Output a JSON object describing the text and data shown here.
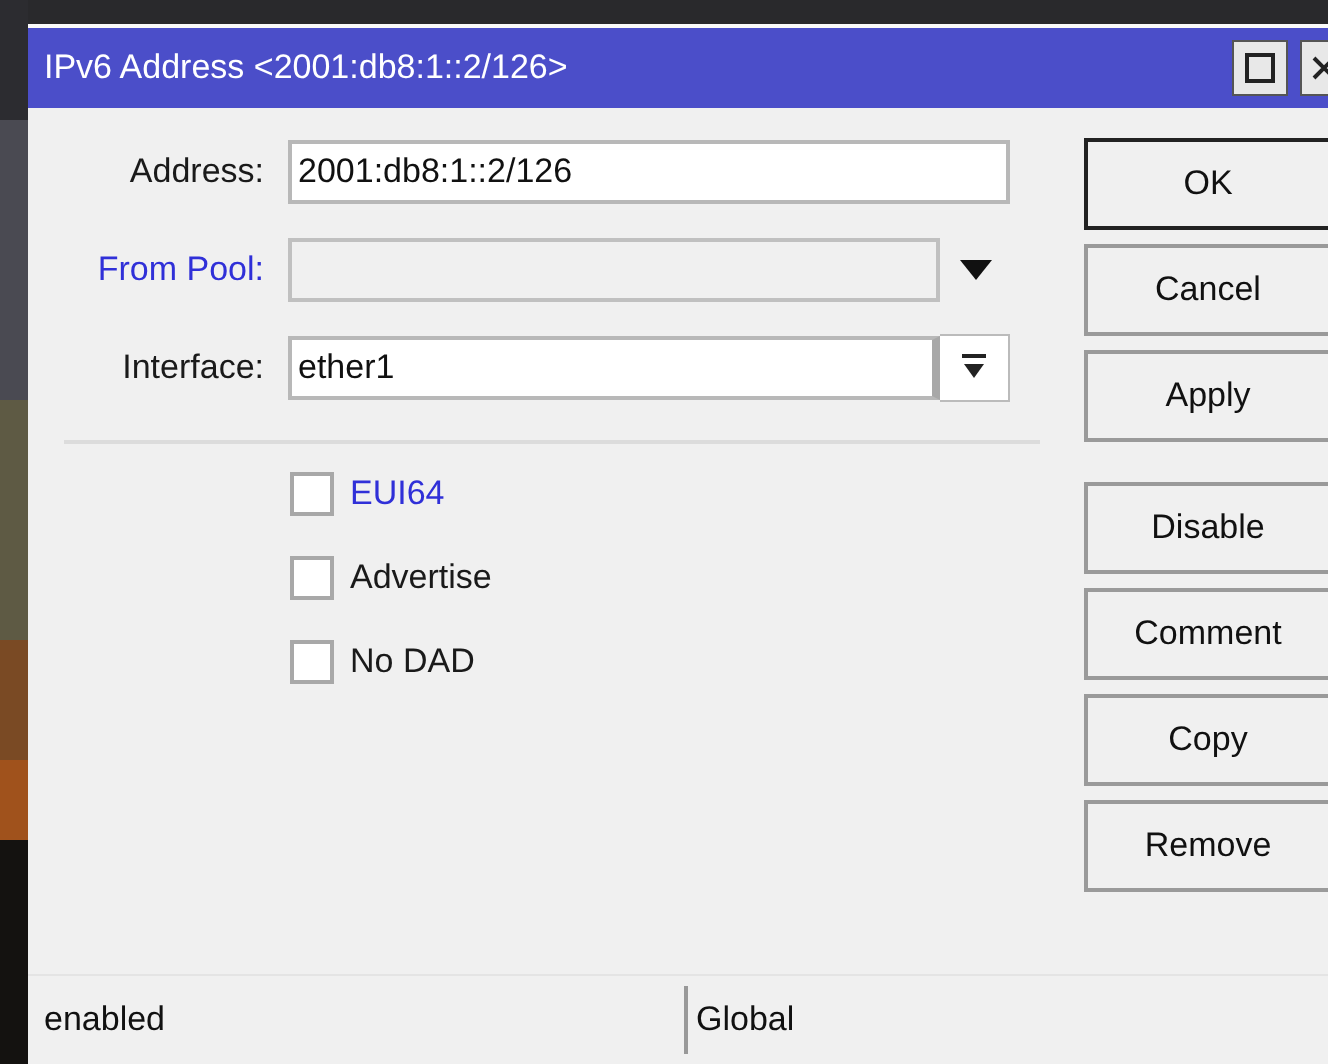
{
  "window": {
    "title": "IPv6 Address <2001:db8:1::2/126>"
  },
  "fields": [
    {
      "label": "Address:",
      "kind": "text",
      "value": "2001:db8:1::2/126",
      "color": "#1a1a1a",
      "disabled": false
    },
    {
      "label": "From Pool:",
      "kind": "dropdown",
      "color": "#3030d8",
      "disabled": true
    },
    {
      "label": "Interface:",
      "kind": "select",
      "value": "ether1",
      "color": "#1a1a1a",
      "disabled": false
    }
  ],
  "checkboxes": [
    {
      "label": "EUI64",
      "checked": false,
      "color": "#3030d8"
    },
    {
      "label": "Advertise",
      "checked": false,
      "color": "#1a1a1a"
    },
    {
      "label": "No DAD",
      "checked": false,
      "color": "#1a1a1a"
    }
  ],
  "buttons": [
    {
      "label": "OK",
      "default": true
    },
    {
      "label": "Cancel",
      "default": false
    },
    {
      "label": "Apply",
      "default": false
    },
    {
      "label": "Disable",
      "default": false
    },
    {
      "label": "Comment",
      "default": false
    },
    {
      "label": "Copy",
      "default": false
    },
    {
      "label": "Remove",
      "default": false
    }
  ],
  "status_bar": [
    "enabled",
    "Global"
  ]
}
